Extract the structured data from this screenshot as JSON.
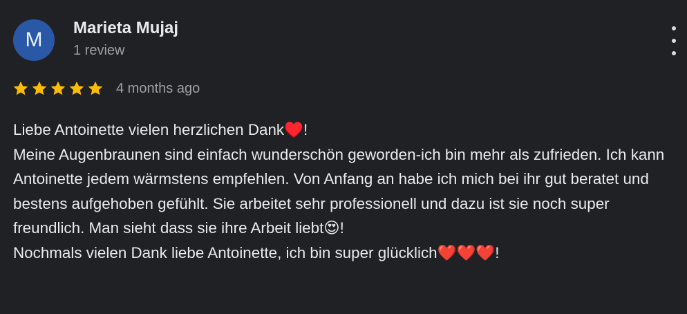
{
  "review": {
    "author": {
      "initial": "M",
      "name": "Marieta Mujaj",
      "review_count": "1 review",
      "avatar_color": "#2b58a6"
    },
    "rating": {
      "stars": 5,
      "max": 5,
      "star_color": "#fbbc04",
      "icon": "star-icon"
    },
    "timestamp": "4 months ago",
    "more_options_icon": "more-vert-icon",
    "text": "Liebe Antoinette vielen herzlichen Dank♥️!\nMeine Augenbraunen sind einfach wunderschön geworden-ich bin mehr als zufrieden. Ich kann Antoinette jedem wärmstens empfehlen. Von Anfang an habe ich mich bei ihr gut beratet und bestens aufgehoben gefühlt. Sie arbeitet sehr professionell und dazu ist sie noch super freundlich. Man sieht dass sie ihre Arbeit liebt😍!\nNochmals vielen Dank liebe Antoinette, ich bin super glücklich❤️❤️❤️!"
  }
}
